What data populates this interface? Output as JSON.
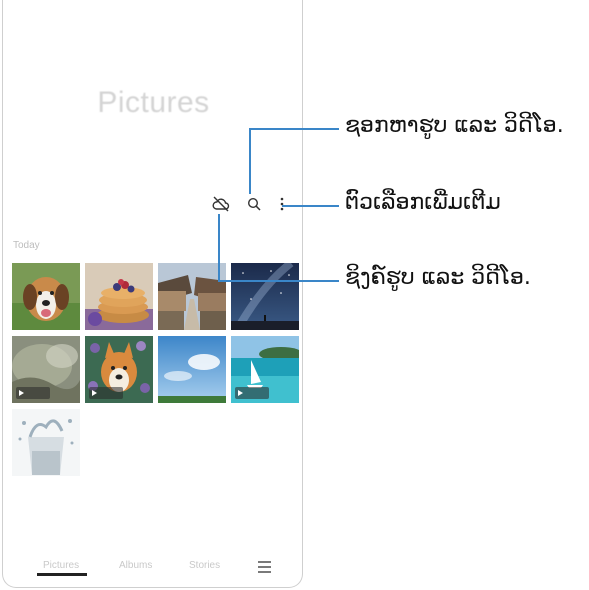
{
  "screen": {
    "title": "Pictures",
    "date_label": "Today",
    "bottom_nav": {
      "tabs": [
        "Pictures",
        "Albums",
        "Stories"
      ],
      "active_tab": "Pictures"
    }
  },
  "toolbar": {
    "icons": [
      "cloud-off-icon",
      "search-icon",
      "more-options-icon"
    ]
  },
  "thumbnails": [
    {
      "subject": "beagle dog",
      "video": false
    },
    {
      "subject": "pancakes with berries",
      "video": false
    },
    {
      "subject": "traditional village street",
      "video": false
    },
    {
      "subject": "starry night sky",
      "video": false
    },
    {
      "subject": "water close-up",
      "video": true
    },
    {
      "subject": "corgi dog with flowers",
      "video": true
    },
    {
      "subject": "blue sky and field",
      "video": false
    },
    {
      "subject": "sailboat on turquoise sea",
      "video": true
    },
    {
      "subject": "water splash in glass",
      "video": false
    }
  ],
  "callouts": {
    "search": "ຊອກຫາຮູບ ແລະ ວິດີໂອ.",
    "more_options": "ຕົວເລືອກເພີ່ມເຕີມ",
    "sync": "ຊິງຄ໌ຮູບ ແລະ ວິດີໂອ."
  },
  "colors": {
    "callout_line": "#3a86c8"
  }
}
